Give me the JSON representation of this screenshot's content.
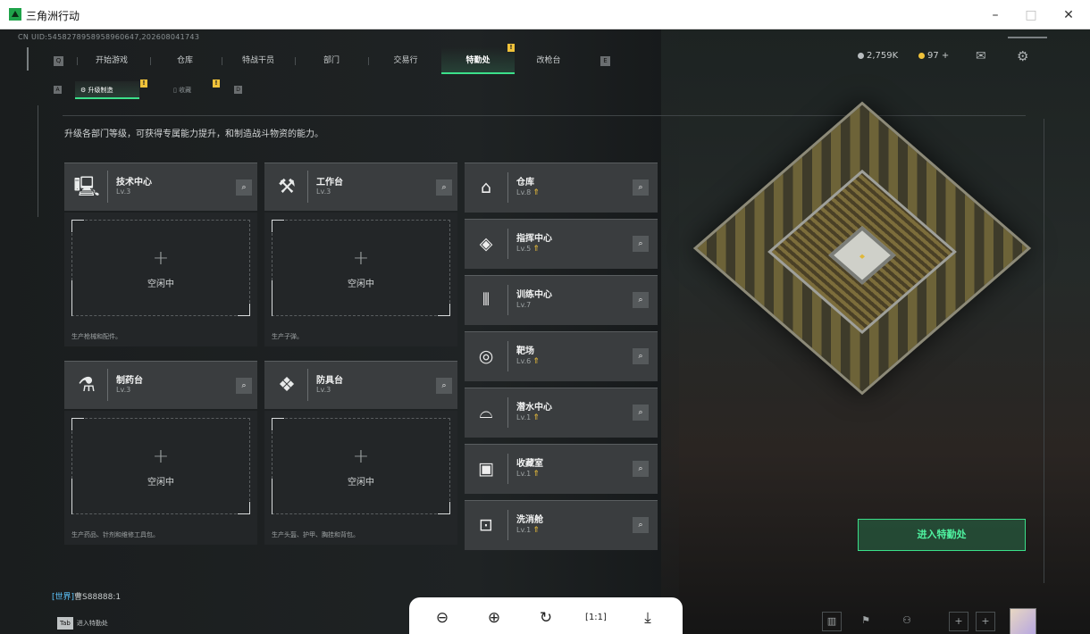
{
  "window": {
    "title": "三角洲行动",
    "minimize": "–",
    "maximize": "□",
    "close": "✕"
  },
  "uid": "CN UID:545827895895896064​7,202608041743",
  "top_nav": {
    "left_key": "Q",
    "right_key": "E",
    "tabs": [
      "开始游戏",
      "仓库",
      "特战干员",
      "部门",
      "交易行",
      "特勤处",
      "改枪台"
    ],
    "active_tab": "特勤处",
    "badge": "!"
  },
  "resources": {
    "coins": "2,759K",
    "tickets": "97 +"
  },
  "sub_nav": {
    "left_key": "A",
    "right_key": "D",
    "tabs": [
      "升级制造",
      "收藏"
    ],
    "badge": "!"
  },
  "description": "升级各部门等级，可获得专属能力提升，和制造战斗物资的能力。",
  "workshops": [
    {
      "name": "技术中心",
      "level": "Lv.3",
      "status": "空闲中",
      "hint": "生产枪械和配件。"
    },
    {
      "name": "工作台",
      "level": "Lv.3",
      "status": "空闲中",
      "hint": "生产子弹。"
    },
    {
      "name": "制药台",
      "level": "Lv.3",
      "status": "空闲中",
      "hint": "生产药品、针剂和维修工具包。"
    },
    {
      "name": "防具台",
      "level": "Lv.3",
      "status": "空闲中",
      "hint": "生产头盔、护甲、胸挂和背包。"
    }
  ],
  "facilities": [
    {
      "name": "仓库",
      "level": "Lv.8",
      "upgradable": true
    },
    {
      "name": "指挥中心",
      "level": "Lv.5",
      "upgradable": true
    },
    {
      "name": "训练中心",
      "level": "Lv.7",
      "upgradable": false
    },
    {
      "name": "靶场",
      "level": "Lv.6",
      "upgradable": true
    },
    {
      "name": "潜水中心",
      "level": "Lv.1",
      "upgradable": true
    },
    {
      "name": "收藏室",
      "level": "Lv.1",
      "upgradable": true
    },
    {
      "name": "洗消舱",
      "level": "Lv.1",
      "upgradable": true
    }
  ],
  "enter_button": "进入特勤处",
  "chat": {
    "channel": "[世界]",
    "user": "曹S88888",
    "message": ":1"
  },
  "tab_hint": {
    "key": "Tab",
    "label": "进入特勤处"
  },
  "viewer_tools": [
    "zoom-out",
    "zoom-in",
    "rotate",
    "actual-size",
    "download"
  ],
  "colors": {
    "accent": "#3be08a",
    "badge": "#f0c23a",
    "card": "#3a3d3f"
  }
}
